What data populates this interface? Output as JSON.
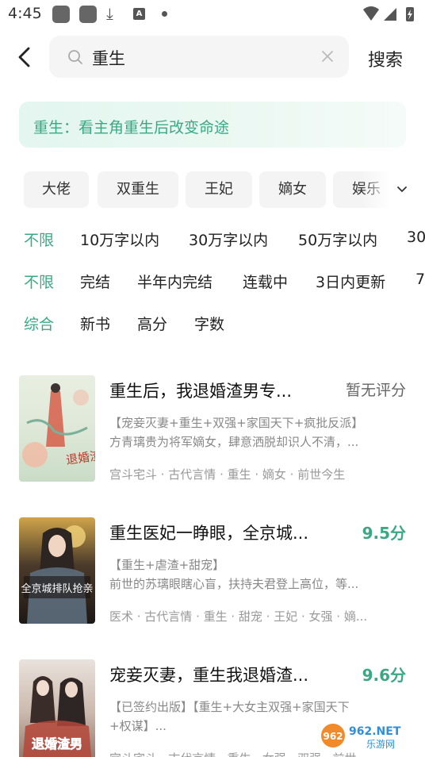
{
  "status_bar": {
    "time": "4:45"
  },
  "search": {
    "query": "重生",
    "button_label": "搜索"
  },
  "hint": {
    "text": "重生：看主角重生后改变命途"
  },
  "tags": [
    "大佬",
    "双重生",
    "王妃",
    "嫡女",
    "娱乐"
  ],
  "filters": {
    "word_count": [
      "不限",
      "10万字以内",
      "30万字以内",
      "50万字以内",
      "30"
    ],
    "status": [
      "不限",
      "完结",
      "半年内完结",
      "连载中",
      "3日内更新",
      "7"
    ],
    "sort": [
      "综合",
      "新书",
      "高分",
      "字数"
    ]
  },
  "books": [
    {
      "title": "重生后，我退婚渣男专...",
      "score": "暂无评分",
      "desc1": "【宠妾灭妻+重生+双强+家国天下+疯批反派】",
      "desc2": "方青璃贵为将军嫡女，肆意洒脱却识人不清，...",
      "tags": "宫斗宅斗 · 古代言情 · 重生 · 嫡女 · 前世今生",
      "cover_text": "退婚渣男"
    },
    {
      "title": "重生医妃一睁眼，全京城...",
      "score": "9.5分",
      "desc1": "【重生+虐渣+甜宠】",
      "desc2": "前世的苏璃眼瞎心盲，扶持夫君登上高位，等...",
      "tags": "医术 · 古代言情 · 重生 · 甜宠 · 王妃 · 女强 · 嫡...",
      "cover_text": "全京城排队抢亲"
    },
    {
      "title": "宠妾灭妻，重生我退婚渣...",
      "score": "9.6分",
      "desc1": "【已签约出版】【重生+大女主双强+家国天下",
      "desc2": "+权谋】...",
      "tags": "宫斗宅斗 · 古代言情 · 重生 · 女强 · 双强 · 前世...",
      "cover_text": "退婚渣男"
    }
  ],
  "watermark": {
    "brand": "962.NET",
    "sub": "乐游网"
  },
  "colors": {
    "accent": "#3aa983",
    "hint_bg": "#e3f6ef",
    "chip_bg": "#f4f4f4"
  }
}
